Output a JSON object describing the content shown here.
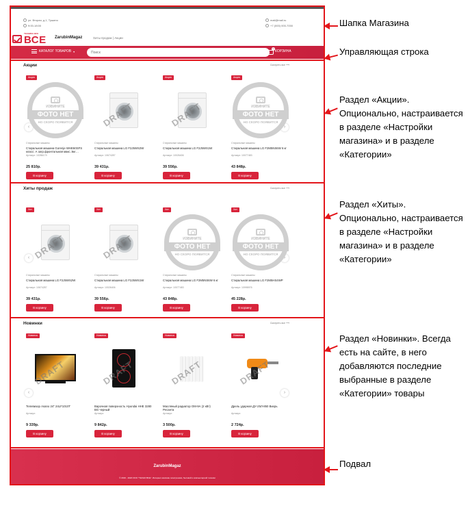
{
  "header": {
    "address": "ул. Вторая, д.1, Тушино",
    "hours": "9:00-18:00",
    "email": "mail@mail.ru",
    "phone": "+7 (000) 000-7000",
    "logo_small": "ТЕХНИКА ВСЕ",
    "logo_big": "ВСЕ",
    "brand": "ZarubinMagaz",
    "nav": "Хиты продаж  |  Акции"
  },
  "control_bar": {
    "catalog_label": "КАТАЛОГ ТОВАРОВ",
    "search_placeholder": "Поиск",
    "cart_label": "КОРЗИНА",
    "cart_count": "0"
  },
  "sections": [
    {
      "title": "Акции",
      "see_all": "Смотреть все",
      "products": [
        {
          "badge": "Акция",
          "image": "placeholder",
          "category": "Стиральные машины",
          "name": "Стиральная машина Gorenje WHE60SFS класс: А загр.фронтальная макс.:6кг…",
          "sku": "Артикул: 10286179",
          "price": "25 810р.",
          "button": "В корзину"
        },
        {
          "badge": "Акция",
          "image": "washer",
          "category": "Стиральные машины",
          "name": "Стиральная машина LG F2J5WS2W",
          "sku": "Артикул: 10674287",
          "price": "39 431р.",
          "button": "В корзину"
        },
        {
          "badge": "Акция",
          "image": "washer",
          "category": "Стиральные машины",
          "name": "Стиральная машина LG F2J5WS1W",
          "sku": "Артикул: 10026406",
          "price": "39 556р.",
          "button": "В корзину"
        },
        {
          "badge": "Акция",
          "image": "placeholder",
          "category": "Стиральные машины",
          "name": "Стиральная машина LG F2M5NS6W 6 кг",
          "sku": "Артикул: 10077483",
          "price": "43 848р.",
          "button": "В корзину"
        }
      ]
    },
    {
      "title": "Хиты продаж",
      "see_all": "Смотреть все",
      "products": [
        {
          "badge": "Хит",
          "image": "washer",
          "category": "Стиральные машины",
          "name": "Стиральная машина LG F2J5WS2W",
          "sku": "Артикул: 10674287",
          "price": "39 431р.",
          "button": "В корзину"
        },
        {
          "badge": "Хит",
          "image": "washer",
          "category": "Стиральные машины",
          "name": "Стиральная машина LG F2J5WS1W",
          "sku": "Артикул: 10026406",
          "price": "39 556р.",
          "button": "В корзину"
        },
        {
          "badge": "Хит",
          "image": "placeholder",
          "category": "Стиральные машины",
          "name": "Стиральная машина LG F2M5NS6W 6 кг",
          "sku": "Артикул: 10077483",
          "price": "43 848р.",
          "button": "В корзину"
        },
        {
          "badge": "Хит",
          "image": "placeholder",
          "category": "Стиральные машины",
          "name": "Стиральная машина LG F2M5HS4WP",
          "sku": "Артикул: 10998976",
          "price": "45 228р.",
          "button": "В корзину"
        }
      ]
    },
    {
      "title": "Новинки",
      "see_all": "Смотреть все",
      "products": [
        {
          "badge": "Новинка",
          "image": "tv",
          "category": "",
          "name": "Телевизор Asano 24\" 24LF1010T",
          "sku": "Артикул:",
          "price": "9 339р.",
          "button": "В корзину"
        },
        {
          "badge": "Новинка",
          "image": "hob",
          "category": "",
          "name": "Варочная поверхность Hyundai HHE 3280 BG черный",
          "sku": "Артикул:",
          "price": "9 842р.",
          "button": "В корзину"
        },
        {
          "badge": "Новинка",
          "image": "heater",
          "category": "",
          "name": "Масляный радиатор ОМ-9А (2 кВт) Ресанта",
          "sku": "Артикул:",
          "price": "3 500р.",
          "button": "В корзину"
        },
        {
          "badge": "Новинка",
          "image": "drill",
          "category": "",
          "name": "Дрель ударная ДУ-25Л-850 Вихрь",
          "sku": "Артикул:",
          "price": "2 724р.",
          "button": "В корзину"
        }
      ]
    }
  ],
  "placeholder": {
    "top": "ИЗВИНИТЕ",
    "middle": "ФОТО НЕТ",
    "bottom": "НО СКОРО ПОЯВИТСЯ"
  },
  "watermark": "DRAFT",
  "footer": {
    "brand": "ZarubinMagaz",
    "copyright": "© 2016 - 2020 ООО \"ТЕХНО ВСЕ\". Интернет-магазин электроники, бытовой и компьютерной техники"
  },
  "annotations": {
    "header": "Шапка Магазина",
    "control_bar": "Управляющая строка",
    "promo": "Раздел «Акции». Опционально, настраивается в разделе «Настройки магазина» и в разделе «Категории»",
    "hits": "Раздел «Хиты». Опционально, настраивается в разделе «Настройки магазина» и в разделе «Категории»",
    "new": "Раздел «Новинки». Всегда есть на сайте, в него добавляются последние выбранные в разделе «Категории» товары",
    "footer": "Подвал"
  },
  "colors": {
    "accent": "#d8243b",
    "frame": "#e3151a"
  }
}
